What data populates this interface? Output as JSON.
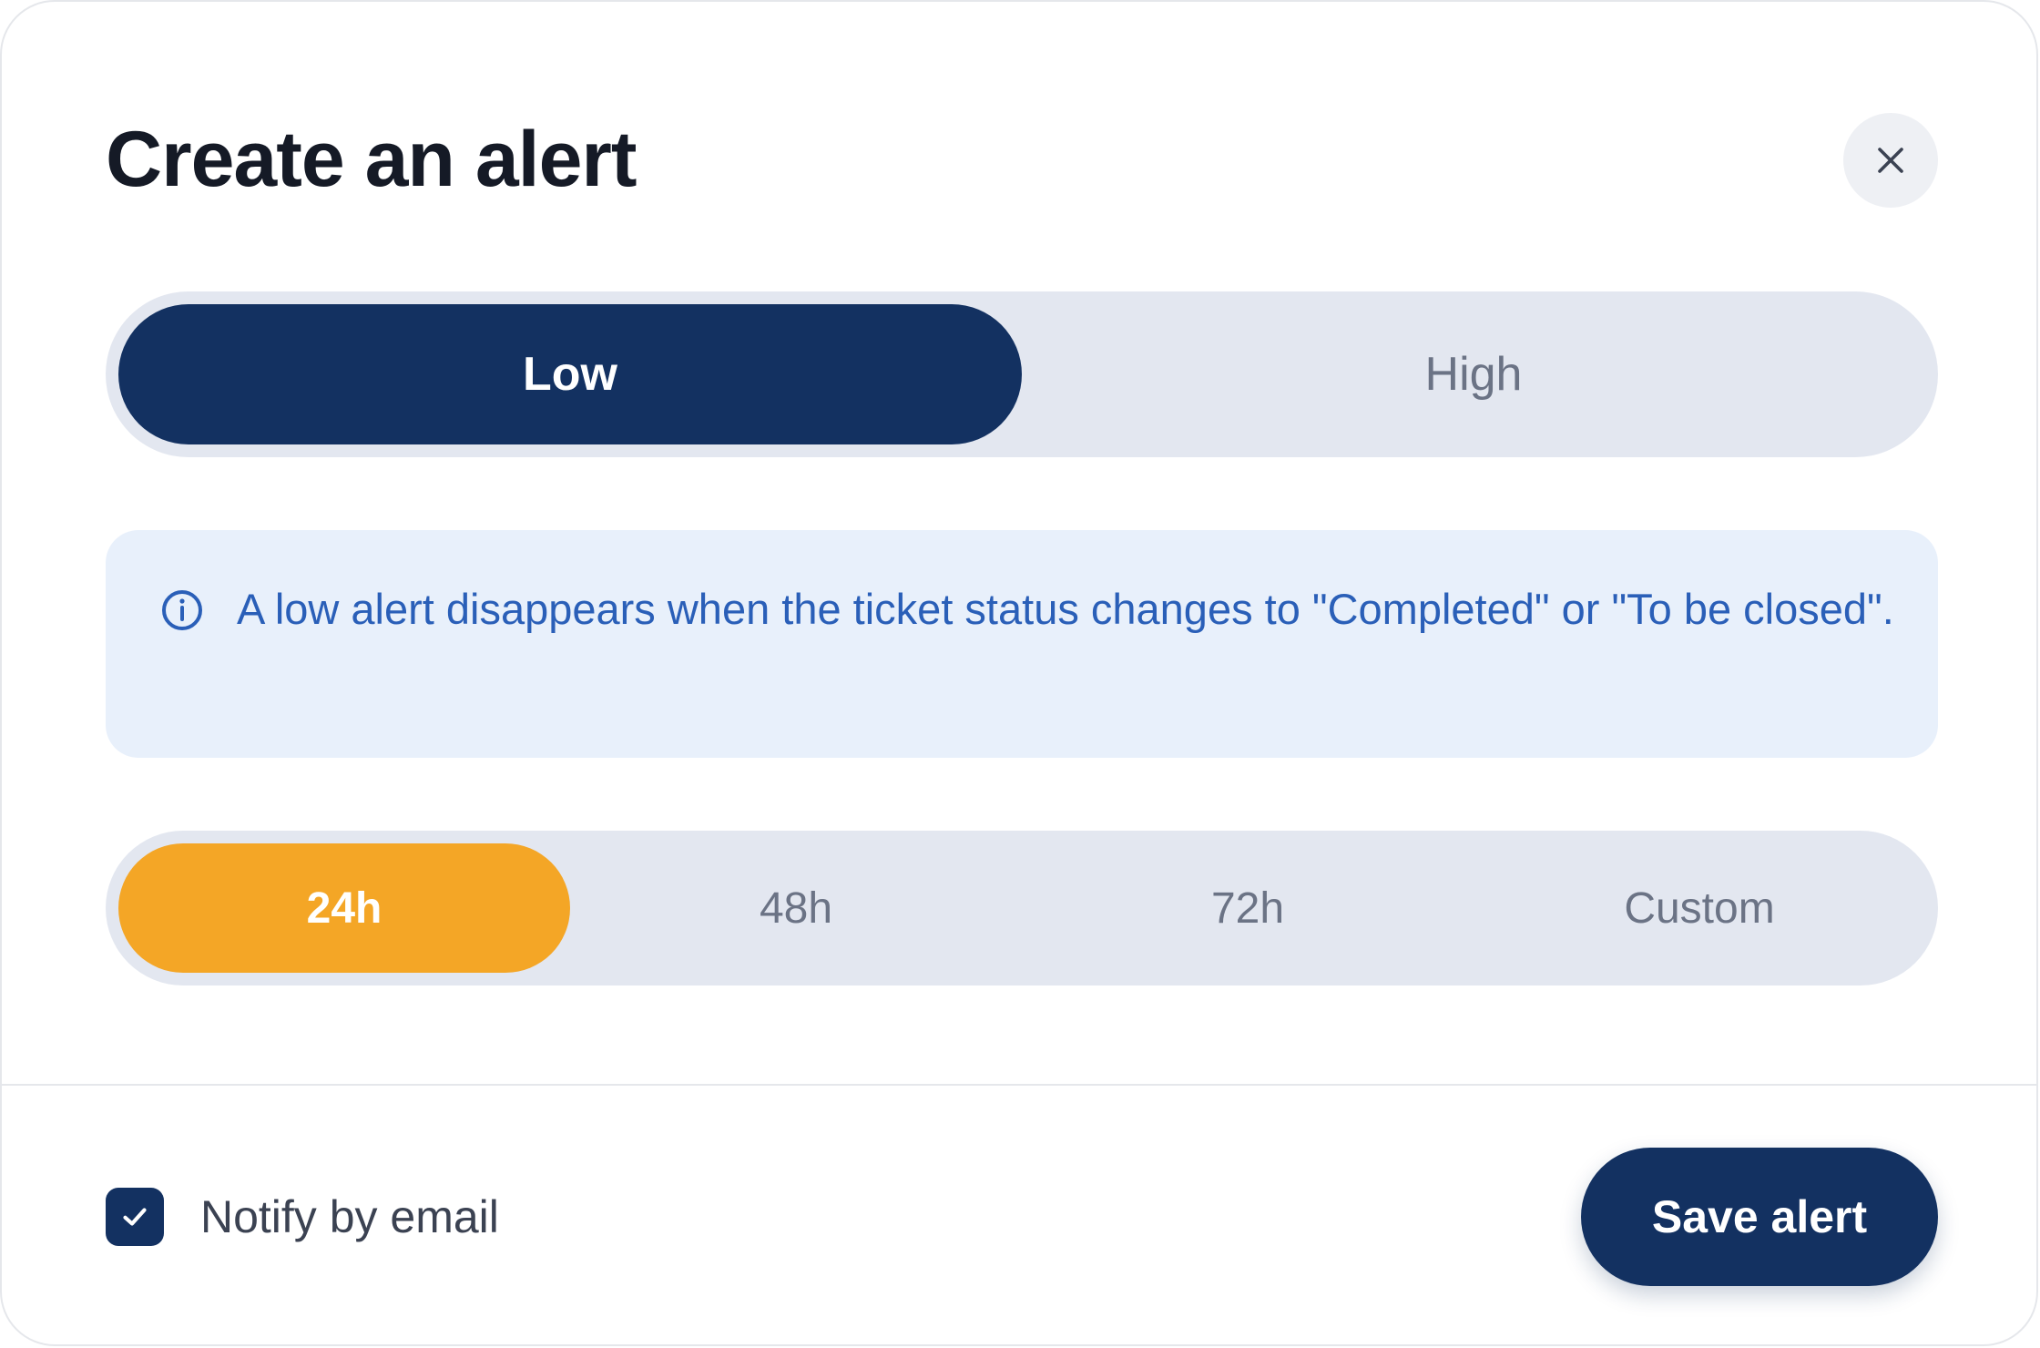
{
  "dialog": {
    "title": "Create an alert",
    "close_icon": "close-icon"
  },
  "priority": {
    "options": [
      "Low",
      "High"
    ],
    "selected": "Low"
  },
  "info": {
    "icon": "info-icon",
    "text": "A low alert disappears when the ticket status changes to \"Completed\" or \"To be closed\"."
  },
  "time_window": {
    "options": [
      "24h",
      "48h",
      "72h",
      "Custom"
    ],
    "selected": "24h"
  },
  "footer": {
    "notify_label": "Notify by email",
    "notify_checked": true,
    "save_label": "Save alert"
  },
  "colors": {
    "navy": "#133161",
    "amber": "#f4a626",
    "info_bg": "#e8f0fb",
    "info_text": "#2a5fb8",
    "segment_bg": "#e3e7f0"
  }
}
